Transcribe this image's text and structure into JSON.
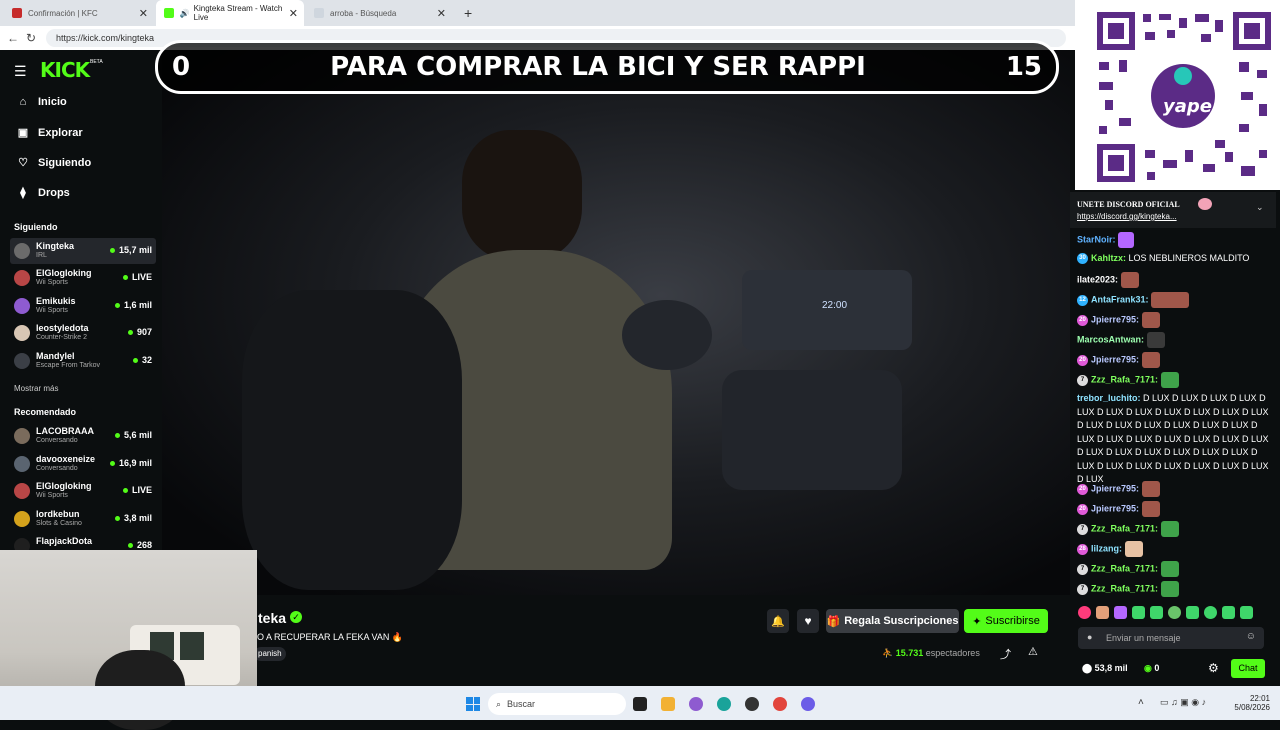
{
  "browser": {
    "tabs": [
      {
        "title": "Confirmación | KFC",
        "icon": "kfc-icon"
      },
      {
        "title": "Kingteka Stream - Watch Live",
        "icon": "kick-icon"
      },
      {
        "title": "arroba - Búsqueda",
        "icon": "search-icon"
      }
    ],
    "new_tab": "+",
    "url": "https://kick.com/kingteka"
  },
  "kick": {
    "logo": "KICK",
    "beta": "BETA",
    "nav": [
      {
        "label": "Inicio",
        "icon": "home-icon",
        "glyph": "⌂"
      },
      {
        "label": "Explorar",
        "icon": "compass-icon",
        "glyph": "▣"
      },
      {
        "label": "Siguiendo",
        "icon": "heart-icon",
        "glyph": "♡"
      },
      {
        "label": "Drops",
        "icon": "drops-icon",
        "glyph": "⧫"
      }
    ],
    "following_header": "Siguiendo",
    "following": [
      {
        "name": "Kingteka",
        "game": "IRL",
        "viewers": "15,7 mil"
      },
      {
        "name": "ElGlogloking",
        "game": "Wii Sports",
        "viewers": "LIVE"
      },
      {
        "name": "Emikukis",
        "game": "Wii Sports",
        "viewers": "1,6 mil"
      },
      {
        "name": "leostyledota",
        "game": "Counter-Strike 2",
        "viewers": "907"
      },
      {
        "name": "Mandylel",
        "game": "Escape From Tarkov",
        "viewers": "32"
      }
    ],
    "show_more": "Mostrar más",
    "recommended_header": "Recomendado",
    "recommended": [
      {
        "name": "LACOBRAAA",
        "game": "Conversando",
        "viewers": "5,6 mil"
      },
      {
        "name": "davooxeneize",
        "game": "Conversando",
        "viewers": "16,9 mil"
      },
      {
        "name": "ElGlogloking",
        "game": "Wii Sports",
        "viewers": "LIVE"
      },
      {
        "name": "lordkebun",
        "game": "Slots & Casino",
        "viewers": "3,8 mil"
      },
      {
        "name": "FlapjackDota",
        "game": "",
        "viewers": "268"
      }
    ]
  },
  "overlay": {
    "left_count": "0",
    "text": "PARA COMPRAR LA BICI Y SER RAPPI",
    "right_count": "15"
  },
  "stream": {
    "channel": "teka",
    "title": "O A RECUPERAR LA FEKA VAN",
    "tag": "panish",
    "gift_label": "Regala Suscripciones",
    "subscribe_label": "Suscribirse",
    "viewers": "15.731",
    "viewers_label": "espectadores"
  },
  "qr": {
    "brand": "yape"
  },
  "chat": {
    "pinned_title": "UNETE DISCORD OFICIAL",
    "pinned_link": "https://discord.gg/kingteka...",
    "messages": [
      {
        "user": "StarNoir:",
        "text": "",
        "color": "#5fb2ff"
      },
      {
        "user": "Kahltzx:",
        "text": "LOS NEBLINEROS MALDITO",
        "color": "#7fff5e"
      },
      {
        "user": "ilate2023:",
        "text": "",
        "color": "#ffffff"
      },
      {
        "user": "AntaFrank31:",
        "text": "",
        "color": "#8fe3ff"
      },
      {
        "user": "Jpierre795:",
        "text": "",
        "color": "#b9c9ff"
      },
      {
        "user": "MarcosAntwan:",
        "text": "",
        "color": "#9dffb0"
      },
      {
        "user": "Jpierre795:",
        "text": "",
        "color": "#b9c9ff"
      },
      {
        "user": "Zzz_Rafa_7171:",
        "text": "",
        "color": "#7fff5e"
      },
      {
        "user": "trebor_luchito:",
        "text": "D LUX D LUX D LUX D LUX D LUX D LUX D LUX D LUX D LUX D LUX D LUX D LUX D LUX D LUX D LUX D LUX D LUX D LUX D LUX D LUX D LUX D LUX D LUX D LUX D LUX D LUX D LUX D LUX D LUX D LUX D LUX D LUX D LUX D LUX D LUX D LUX D LUX D LUX",
        "color": "#8fe3ff"
      },
      {
        "user": "Jpierre795:",
        "text": "",
        "color": "#b9c9ff"
      },
      {
        "user": "Jpierre795:",
        "text": "",
        "color": "#b9c9ff"
      },
      {
        "user": "Zzz_Rafa_7171:",
        "text": "",
        "color": "#7fff5e"
      },
      {
        "user": "lilzang:",
        "text": "",
        "color": "#8fe3ff"
      },
      {
        "user": "Zzz_Rafa_7171:",
        "text": "",
        "color": "#7fff5e"
      },
      {
        "user": "Zzz_Rafa_7171:",
        "text": "",
        "color": "#7fff5e"
      }
    ],
    "input_placeholder": "Enviar un mensaje",
    "points": "53,8 mil",
    "kicks": "0",
    "chat_button": "Chat"
  },
  "taskbar": {
    "search": "Buscar",
    "time": "22:01",
    "date": "5/08/2026"
  },
  "colors": {
    "kick_green": "#53fc18",
    "dark": "#0b0e0f"
  }
}
